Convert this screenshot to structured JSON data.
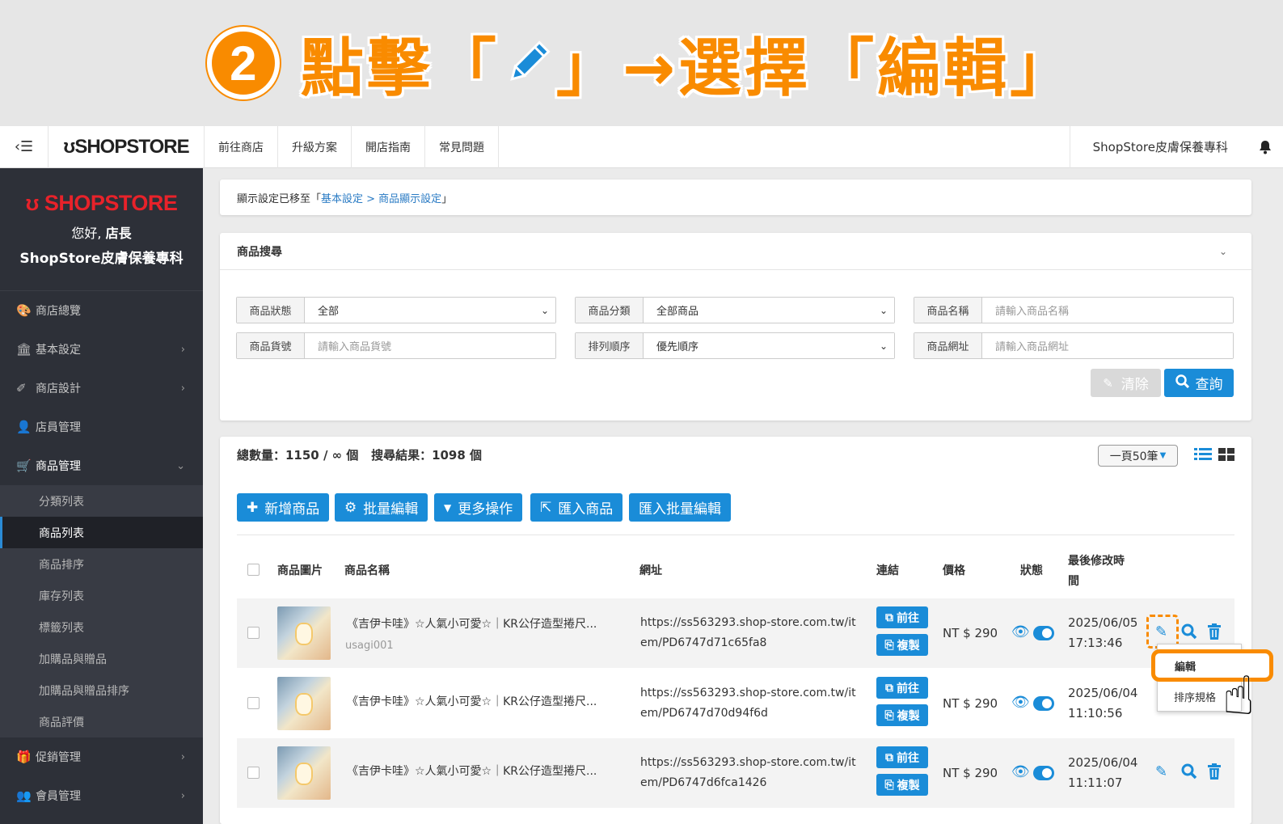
{
  "banner": {
    "step": "2",
    "text_before": "點擊「",
    "text_after": "」→選擇「編輯」",
    "pencil_icon": "pencil-icon"
  },
  "topbar": {
    "menu_toggle": "‹☰",
    "logo": "ʊSHOPSTORE",
    "nav": [
      "前往商店",
      "升級方案",
      "開店指南",
      "常見問題"
    ],
    "store_name": "ShopStore皮膚保養專科",
    "bell_icon": "bell-icon"
  },
  "sidebar": {
    "logo": "ʊ SHOPSTORE",
    "hello": "您好,",
    "role": "店長",
    "store": "ShopStore皮膚保養專科",
    "items": [
      {
        "label": "商店總覽",
        "icon": "palette-icon",
        "glyph": "🎨",
        "chev": ""
      },
      {
        "label": "基本設定",
        "icon": "bank-icon",
        "glyph": "🏛",
        "chev": "›"
      },
      {
        "label": "商店設計",
        "icon": "magic-wand-icon",
        "glyph": "✐",
        "chev": "›"
      },
      {
        "label": "店員管理",
        "icon": "user-lock-icon",
        "glyph": "👤",
        "chev": ""
      },
      {
        "label": "商品管理",
        "icon": "cart-icon",
        "glyph": "🛒",
        "chev": "⌄"
      }
    ],
    "sub": [
      "分類列表",
      "商品列表",
      "商品排序",
      "庫存列表",
      "標籤列表",
      "加購品與贈品",
      "加購品與贈品排序",
      "商品評價"
    ],
    "bottom": [
      {
        "label": "促銷管理",
        "icon": "gift-icon",
        "glyph": "🎁",
        "chev": "›"
      },
      {
        "label": "會員管理",
        "icon": "users-icon",
        "glyph": "👥",
        "chev": "›"
      }
    ]
  },
  "notice": {
    "prefix": "顯示設定已移至「",
    "link": "基本設定 > 商品顯示設定",
    "suffix": "」"
  },
  "search": {
    "title": "商品搜尋",
    "chev": "⌄",
    "fields": {
      "status": {
        "label": "商品狀態",
        "value": "全部"
      },
      "category": {
        "label": "商品分類",
        "value": "全部商品"
      },
      "name": {
        "label": "商品名稱",
        "placeholder": "請輸入商品名稱"
      },
      "sku": {
        "label": "商品貨號",
        "placeholder": "請輸入商品貨號"
      },
      "order": {
        "label": "排列順序",
        "value": "優先順序"
      },
      "url": {
        "label": "商品網址",
        "placeholder": "請輸入商品網址"
      }
    },
    "clear": "清除",
    "query": "查詢"
  },
  "list": {
    "total": "總數量：1150 / ∞ 個",
    "result": "搜尋結果：1098 個",
    "per_page": "一頁50筆",
    "actions": [
      "新增商品",
      "批量編輯",
      "更多操作",
      "匯入商品",
      "匯入批量編輯"
    ],
    "headers": {
      "image": "商品圖片",
      "name": "商品名稱",
      "url": "網址",
      "link": "連結",
      "price": "價格",
      "status": "狀態",
      "modified": "最後修改時間"
    },
    "go": "前往",
    "copy": "複製",
    "rows": [
      {
        "name": "《吉伊卡哇》☆人氣小可愛☆｜KR公仔造型捲尺...",
        "sku": "usagi001",
        "url1": "https://ss563293.shop-store.com.tw/it",
        "url2": "em/PD6747d71c65fa8",
        "price": "NT $ 290",
        "date": "2025/06/05",
        "time": "17:13:46"
      },
      {
        "name": "《吉伊卡哇》☆人氣小可愛☆｜KR公仔造型捲尺...",
        "sku": "",
        "url1": "https://ss563293.shop-store.com.tw/it",
        "url2": "em/PD6747d70d94f6d",
        "price": "NT $ 290",
        "date": "2025/06/04",
        "time": "11:10:56"
      },
      {
        "name": "《吉伊卡哇》☆人氣小可愛☆｜KR公仔造型捲尺...",
        "sku": "",
        "url1": "https://ss563293.shop-store.com.tw/it",
        "url2": "em/PD6747d6fca1426",
        "price": "NT $ 290",
        "date": "2025/06/04",
        "time": "11:11:07"
      }
    ],
    "dropdown": [
      "編輯",
      "排序規格"
    ]
  },
  "colors": {
    "accent": "#1a8cd8",
    "highlight": "#f98b00",
    "sidebar": "#2d3038"
  }
}
